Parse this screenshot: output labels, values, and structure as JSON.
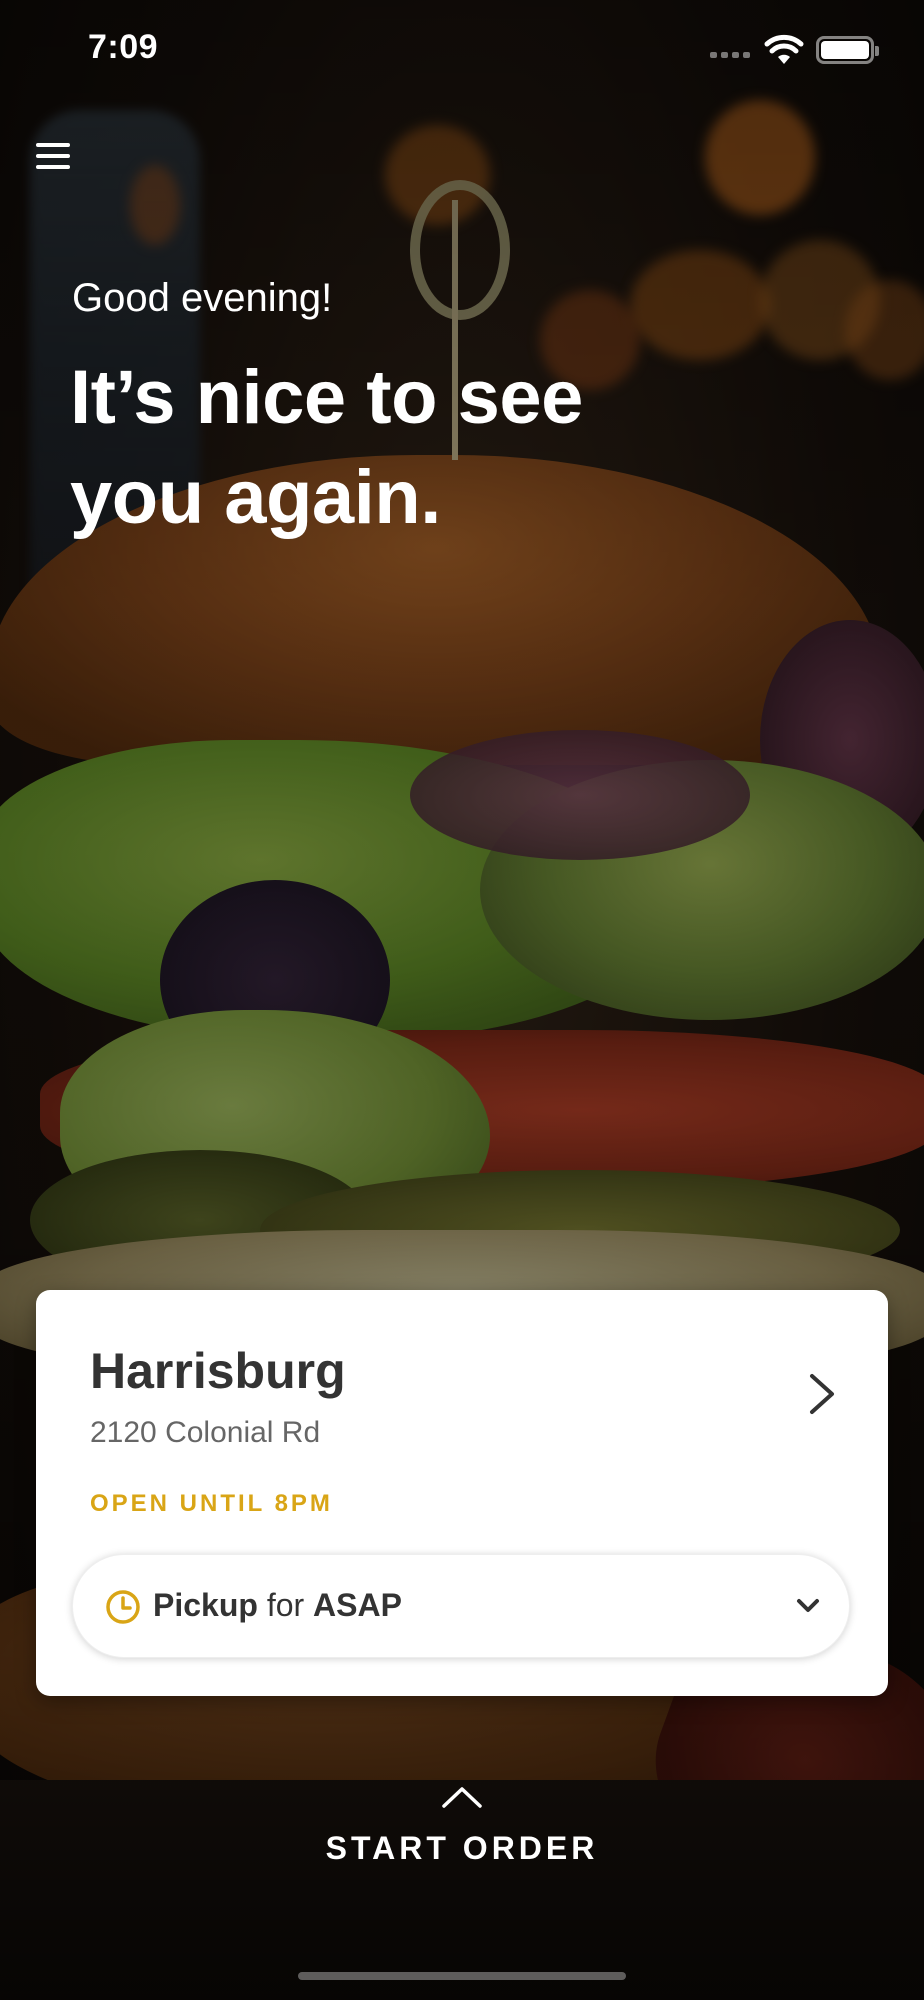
{
  "status_bar": {
    "time": "7:09",
    "icons": [
      "signal-icon",
      "wifi-icon",
      "battery-icon"
    ]
  },
  "menu": {
    "icon": "hamburger-menu-icon"
  },
  "greeting": {
    "salutation": "Good evening!",
    "headline": "It’s nice to see you again."
  },
  "location_card": {
    "name": "Harrisburg",
    "address": "2120 Colonial Rd",
    "hours": "OPEN UNTIL 8PM",
    "hours_color": "#d9a516",
    "chevron_icon": "chevron-right-icon"
  },
  "pickup": {
    "mode": "Pickup",
    "connector": "for",
    "time": "ASAP",
    "clock_icon": "clock-icon",
    "dropdown_icon": "chevron-down-icon",
    "accent_color": "#d9a516"
  },
  "start_order": {
    "label": "START ORDER",
    "icon": "chevron-up-icon"
  }
}
